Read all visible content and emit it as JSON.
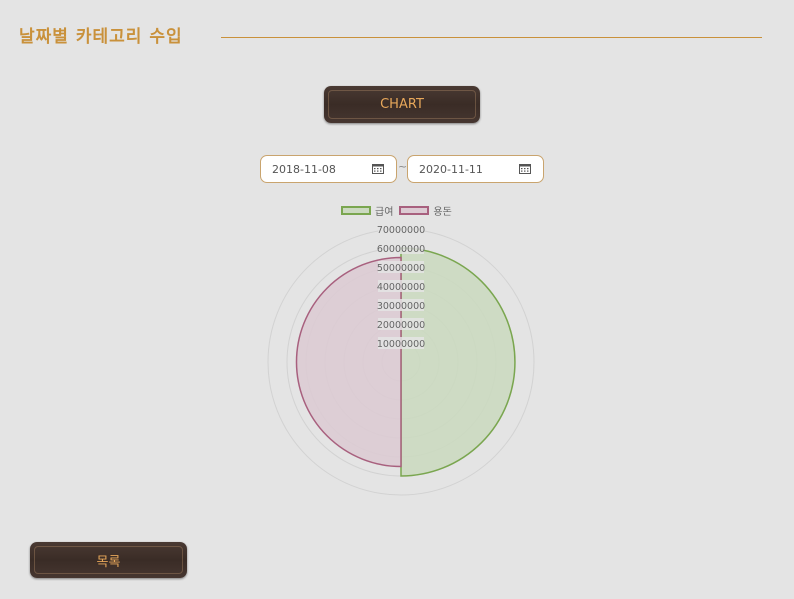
{
  "page": {
    "title": "날짜별 카테고리 수입",
    "chart_button_label": "CHART",
    "list_button_label": "목록"
  },
  "date_range": {
    "start": "2018-11-08",
    "separator": "~",
    "end": "2020-11-11"
  },
  "colors": {
    "accent": "#c9913b",
    "series_1_fill": "#cbd9c0",
    "series_1_stroke": "#7aa64f",
    "series_2_fill": "#dccbd3",
    "series_2_stroke": "#a8607e"
  },
  "chart_data": {
    "type": "polarArea",
    "categories": [
      "급여",
      "용돈"
    ],
    "values": [
      60000000,
      55000000
    ],
    "r_ticks": [
      10000000,
      20000000,
      30000000,
      40000000,
      50000000,
      60000000,
      70000000
    ],
    "r_tick_labels": [
      "10000000",
      "20000000",
      "30000000",
      "40000000",
      "50000000",
      "60000000",
      "70000000"
    ],
    "r_range": [
      0,
      70000000
    ],
    "legend": [
      "급여",
      "용돈"
    ],
    "legend_position": "top",
    "grid": true
  }
}
